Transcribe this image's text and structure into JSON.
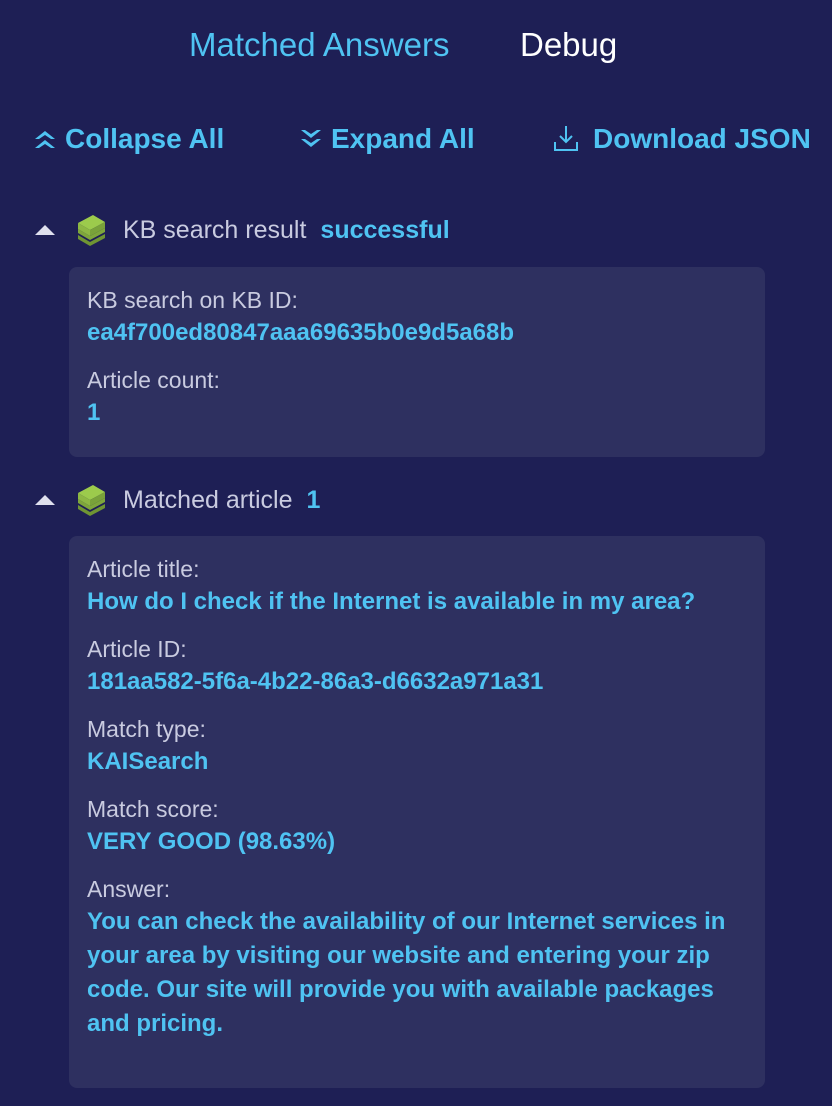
{
  "tabs": {
    "matched_answers": "Matched Answers",
    "debug": "Debug"
  },
  "toolbar": {
    "collapse_all": "Collapse All",
    "expand_all": "Expand All",
    "download_json": "Download JSON"
  },
  "sections": [
    {
      "title": "KB search result",
      "status": "successful",
      "fields": [
        {
          "label": "KB search on KB ID:",
          "value": "ea4f700ed80847aaa69635b0e9d5a68b"
        },
        {
          "label": "Article count:",
          "value": "1"
        }
      ]
    },
    {
      "title": "Matched article",
      "status": "1",
      "fields": [
        {
          "label": "Article title:",
          "value": "How do I check if the Internet is available in my area?"
        },
        {
          "label": "Article ID:",
          "value": "181aa582-5f6a-4b22-86a3-d6632a971a31"
        },
        {
          "label": "Match type:",
          "value": "KAISearch"
        },
        {
          "label": "Match score:",
          "value": "VERY GOOD (98.63%)"
        },
        {
          "label": "Answer:",
          "value": "You can check the availability of our Internet services in your area by visiting our website and entering your zip code. Our site will provide you with available packages and pricing."
        }
      ]
    }
  ],
  "icons": {
    "collapse": "double-chevron-up-icon",
    "expand": "double-chevron-down-icon",
    "download": "download-icon",
    "section_toggle": "caret-up-icon",
    "section_icon": "book-stack-icon"
  },
  "colors": {
    "background": "#1e1f55",
    "card": "#2e3060",
    "accent": "#4fc3f2",
    "label": "#c9cbe0",
    "active_tab": "#ffffff",
    "book": "#8db843"
  }
}
